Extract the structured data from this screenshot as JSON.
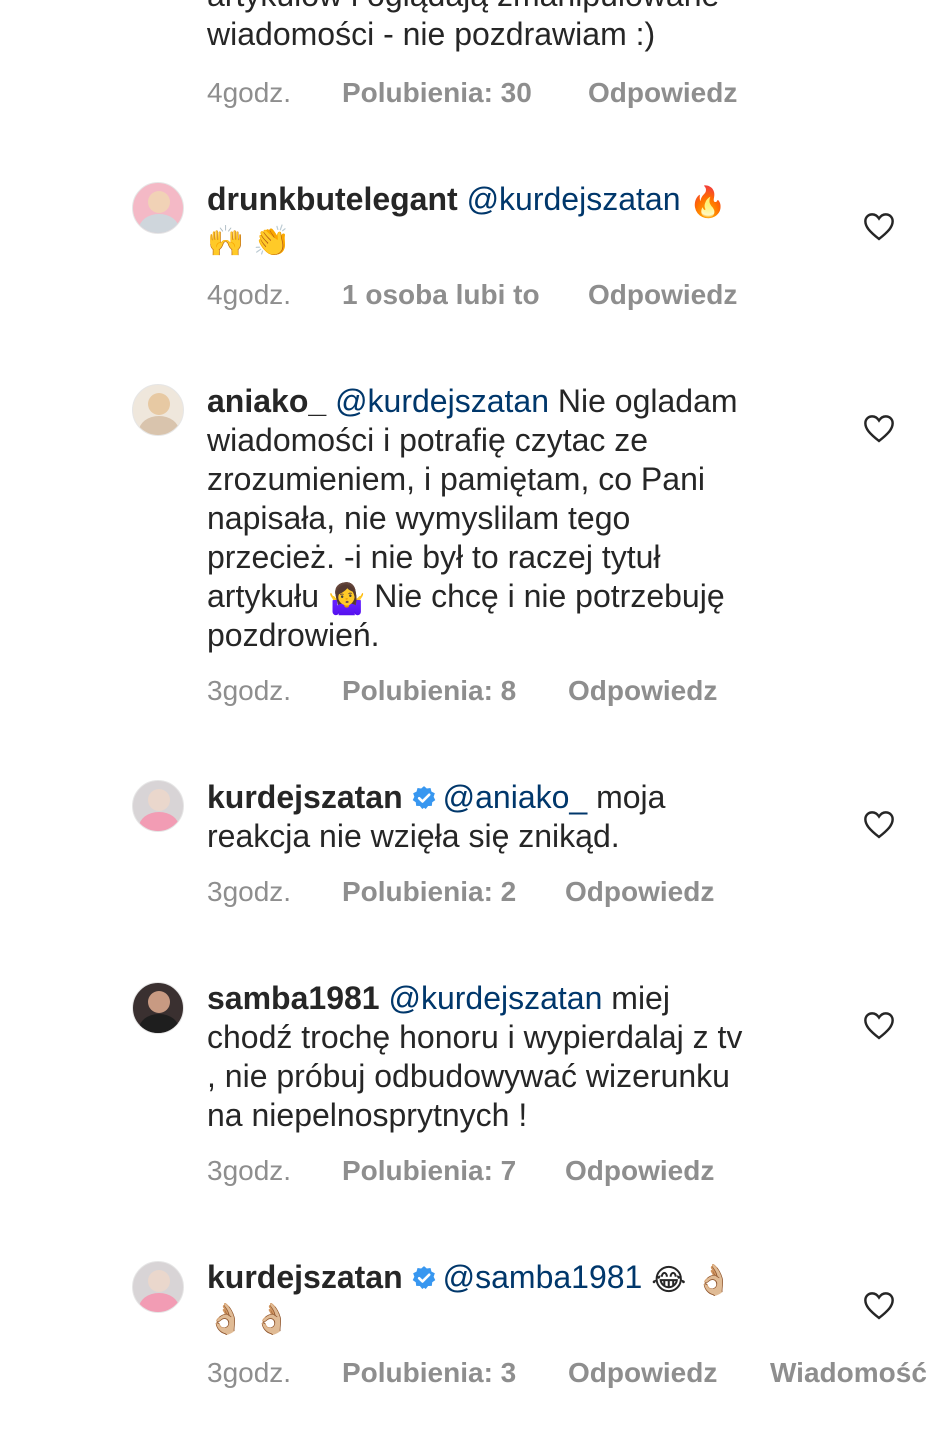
{
  "top": {
    "partial_line": "artykułów i oglądają zmanipulowane",
    "last_line": "wiadomości - nie pozdrawiam :)",
    "time": "4godz.",
    "likes": "Polubienia: 30",
    "reply": "Odpowiedz"
  },
  "comments": [
    {
      "username": "drunkbutelegant",
      "mention": "@kurdejszatan",
      "text": "",
      "emojis": [
        "fire-emoji",
        "raising-hands-emoji",
        "clapping-hands-emoji"
      ],
      "time": "4godz.",
      "likes": "1 osoba lubi to",
      "reply": "Odpowiedz"
    },
    {
      "username": "aniako_",
      "mention": "@kurdejszatan",
      "text_lines": [
        "Nie ogladam",
        "wiadomości i potrafię czytac ze",
        "zrozumieniem, i pamiętam, co Pani",
        "napisała, nie wymyslilam tego",
        "przecież. -i nie był to raczej tytuł",
        "artykułu",
        "Nie chcę i nie potrzebuję",
        "pozdrowień."
      ],
      "emojis": [
        "person-shrugging-emoji"
      ],
      "time": "3godz.",
      "likes": "Polubienia: 8",
      "reply": "Odpowiedz"
    },
    {
      "username": "kurdejszatan",
      "verified": true,
      "mention": "@aniako_",
      "text_lines": [
        "moja",
        "reakcja nie wzięła się znikąd."
      ],
      "time": "3godz.",
      "likes": "Polubienia: 2",
      "reply": "Odpowiedz"
    },
    {
      "username": "samba1981",
      "mention": "@kurdejszatan",
      "text_lines": [
        "miej",
        "chodź trochę honoru i wypierdalaj z tv",
        ", nie próbuj odbudowywać wizerunku",
        "na niepelnosprytnych !"
      ],
      "time": "3godz.",
      "likes": "Polubienia: 7",
      "reply": "Odpowiedz"
    },
    {
      "username": "kurdejszatan",
      "verified": true,
      "mention": "@samba1981",
      "emojis": [
        "laughing-tears-emoji",
        "ok-hand-emoji",
        "ok-hand-emoji",
        "ok-hand-emoji"
      ],
      "time": "3godz.",
      "likes": "Polubienia: 3",
      "reply": "Odpowiedz",
      "message": "Wiadomość"
    }
  ],
  "colors": {
    "text": "#262626",
    "mention": "#00376b",
    "meta": "#8e8e8e",
    "verified": "#3897f0"
  }
}
